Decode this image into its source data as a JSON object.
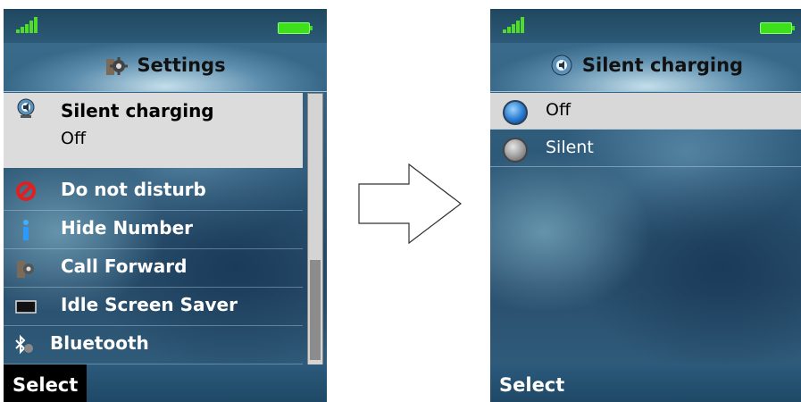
{
  "left_screen": {
    "title": "Settings",
    "selected_item": {
      "label": "Silent charging",
      "value": "Off"
    },
    "items": [
      {
        "label": "Do not disturb",
        "icon": "no-entry-icon"
      },
      {
        "label": "Hide Number",
        "icon": "info-icon"
      },
      {
        "label": "Call Forward",
        "icon": "gear-icon"
      },
      {
        "label": "Idle Screen Saver",
        "icon": "screen-icon"
      },
      {
        "label": "Bluetooth",
        "icon": "bluetooth-icon"
      }
    ],
    "softkey_left": "Select"
  },
  "right_screen": {
    "title": "Silent charging",
    "options": [
      {
        "label": "Off",
        "selected": true
      },
      {
        "label": "Silent",
        "selected": false
      }
    ],
    "softkey_left": "Select"
  },
  "colors": {
    "signal": "#4fdc2a",
    "battery": "#3ee01c",
    "selection": "#dcdcdc",
    "softkey_highlight": "#000000"
  }
}
